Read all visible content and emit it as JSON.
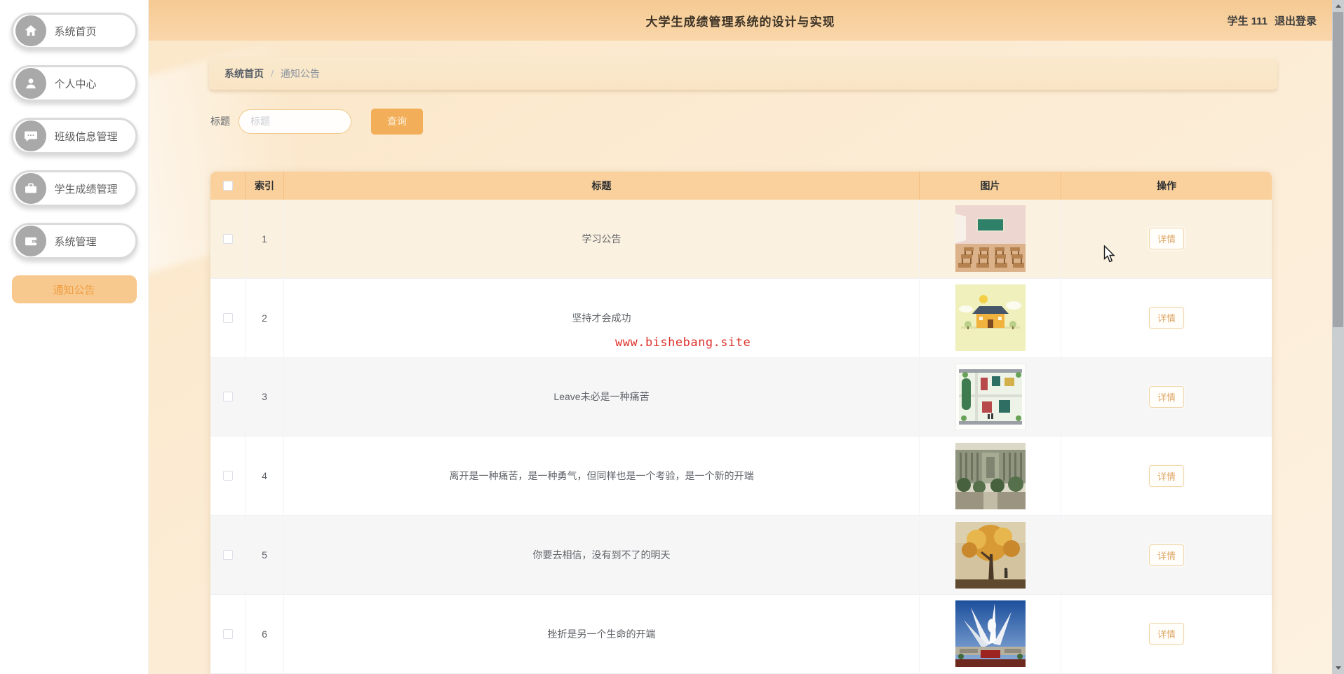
{
  "header": {
    "title": "大学生成绩管理系统的设计与实现",
    "user_label": "学生 111",
    "logout_label": "退出登录"
  },
  "sidebar": {
    "items": [
      {
        "label": "系统首页",
        "icon": "home-icon"
      },
      {
        "label": "个人中心",
        "icon": "user-icon"
      },
      {
        "label": "班级信息管理",
        "icon": "chat-icon"
      },
      {
        "label": "学生成绩管理",
        "icon": "briefcase-icon"
      },
      {
        "label": "系统管理",
        "icon": "wallet-icon"
      }
    ],
    "active_item": {
      "label": "通知公告"
    }
  },
  "breadcrumb": {
    "root": "系统首页",
    "separator": "/",
    "current": "通知公告"
  },
  "search": {
    "label": "标题",
    "placeholder": "标题",
    "value": "",
    "button_label": "查询"
  },
  "watermark": {
    "text": "www.bishebang.site",
    "color": "#de322c"
  },
  "table": {
    "columns": {
      "index": "索引",
      "title": "标题",
      "image": "图片",
      "action": "操作"
    },
    "action_label": "详情",
    "rows": [
      {
        "index": "1",
        "title": "学习公告",
        "image": "classroom-photo"
      },
      {
        "index": "2",
        "title": "坚持才会成功",
        "image": "school-building-illustration"
      },
      {
        "index": "3",
        "title": "Leave未必是一种痛苦",
        "image": "campus-map-illustration"
      },
      {
        "index": "4",
        "title": "离开是一种痛苦，是一种勇气，但同样也是一个考验，是一个新的开端",
        "image": "campus-courtyard-photo"
      },
      {
        "index": "5",
        "title": "你要去相信，没有到不了的明天",
        "image": "autumn-tree-photo"
      },
      {
        "index": "6",
        "title": "挫折是另一个生命的开端",
        "image": "wing-sculpture-photo"
      }
    ]
  },
  "colors": {
    "accent_orange": "#f2ae58",
    "header_bg": "#f6cd9a",
    "table_header_bg": "#fad19c",
    "active_nav_bg": "#f8c98e",
    "active_nav_text": "#ee9c3f",
    "row_hover_bg": "#fbf1e0",
    "watermark_red": "#de322c"
  }
}
